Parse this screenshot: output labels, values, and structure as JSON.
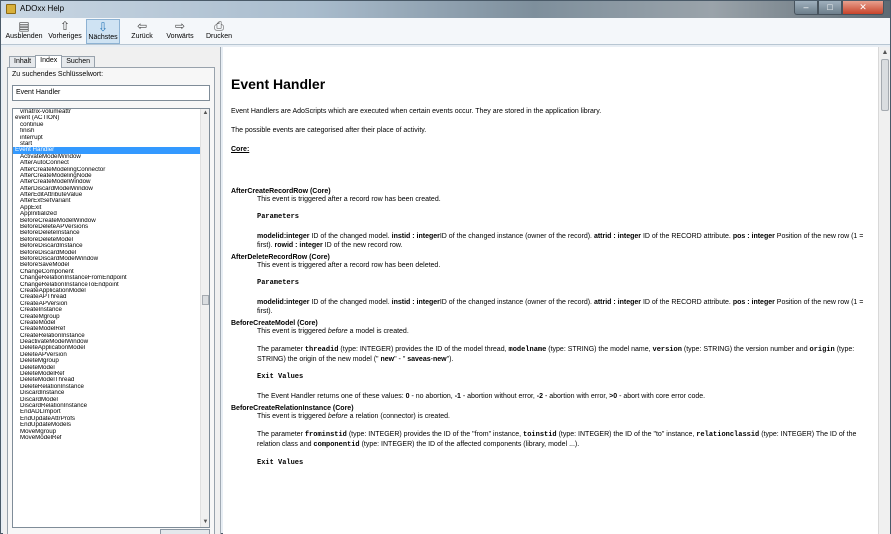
{
  "window": {
    "title": "ADOxx Help",
    "app_icon": "help-book-icon",
    "controls": {
      "minimize": "–",
      "maximize": "□",
      "close": "✕"
    }
  },
  "toolbar": {
    "items": [
      {
        "label": "Ausblenden",
        "icon": "hide-pane-icon",
        "glyph": "▤"
      },
      {
        "label": "Vorheriges",
        "icon": "arrow-up-icon",
        "glyph": "⇧"
      },
      {
        "label": "Nächstes",
        "icon": "arrow-down-icon",
        "glyph": "⇩"
      },
      {
        "label": "Zurück",
        "icon": "arrow-left-icon",
        "glyph": "⇦"
      },
      {
        "label": "Vorwärts",
        "icon": "arrow-right-icon",
        "glyph": "⇨"
      },
      {
        "label": "Drucken",
        "icon": "printer-icon",
        "glyph": "⎙"
      }
    ]
  },
  "nav": {
    "tabs": [
      "Inhalt",
      "Index",
      "Suchen"
    ],
    "active_tab": "Index",
    "keyword_label": "Zu suchendes Schlüsselwort:",
    "keyword_value": "Event Handler",
    "index_items": [
      {
        "t": "vmatrix-volumeattr",
        "sub": true
      },
      {
        "t": "event (ACTION)",
        "sub": false
      },
      {
        "t": "continue",
        "sub": true
      },
      {
        "t": "finish",
        "sub": true
      },
      {
        "t": "interrupt",
        "sub": true
      },
      {
        "t": "start",
        "sub": true
      },
      {
        "t": "Event Handler",
        "sub": false,
        "selected": true
      },
      {
        "t": "ActivateModelWindow",
        "sub": true
      },
      {
        "t": "AfterAutoConnect",
        "sub": true
      },
      {
        "t": "AfterCreateModelingConnector",
        "sub": true
      },
      {
        "t": "AfterCreateModelingNode",
        "sub": true
      },
      {
        "t": "AfterCreateModelWindow",
        "sub": true
      },
      {
        "t": "AfterDiscardModelWindow",
        "sub": true
      },
      {
        "t": "AfterEditAttributeValue",
        "sub": true
      },
      {
        "t": "AfterExtSetVariant",
        "sub": true
      },
      {
        "t": "AppExit",
        "sub": true
      },
      {
        "t": "AppInitialized",
        "sub": true
      },
      {
        "t": "BeforeCreateModelWindow",
        "sub": true
      },
      {
        "t": "BeforeDeleteAPVersions",
        "sub": true
      },
      {
        "t": "BeforeDeleteInstance",
        "sub": true
      },
      {
        "t": "BeforeDeleteModel",
        "sub": true
      },
      {
        "t": "BeforeDiscardInstance",
        "sub": true
      },
      {
        "t": "BeforeDiscardModel",
        "sub": true
      },
      {
        "t": "BeforeDiscardModelWindow",
        "sub": true
      },
      {
        "t": "BeforeSaveModel",
        "sub": true
      },
      {
        "t": "ChangeComponent",
        "sub": true
      },
      {
        "t": "ChangeRelationInstanceFromEndpoint",
        "sub": true
      },
      {
        "t": "ChangeRelationInstanceToEndpoint",
        "sub": true
      },
      {
        "t": "CreateApplicationModel",
        "sub": true
      },
      {
        "t": "CreateAPThread",
        "sub": true
      },
      {
        "t": "CreateAPVersion",
        "sub": true
      },
      {
        "t": "CreateInstance",
        "sub": true
      },
      {
        "t": "CreateMgroup",
        "sub": true
      },
      {
        "t": "CreateModel",
        "sub": true
      },
      {
        "t": "CreateModelRef",
        "sub": true
      },
      {
        "t": "CreateRelationInstance",
        "sub": true
      },
      {
        "t": "DeactivateModelWindow",
        "sub": true
      },
      {
        "t": "DeleteApplicationModel",
        "sub": true
      },
      {
        "t": "DeleteAPVersion",
        "sub": true
      },
      {
        "t": "DeleteMgroup",
        "sub": true
      },
      {
        "t": "DeleteModel",
        "sub": true
      },
      {
        "t": "DeleteModelRef",
        "sub": true
      },
      {
        "t": "DeleteModelThread",
        "sub": true
      },
      {
        "t": "DeleteRelationInstance",
        "sub": true
      },
      {
        "t": "DiscardInstance",
        "sub": true
      },
      {
        "t": "DiscardModel",
        "sub": true
      },
      {
        "t": "DiscardRelationInstance",
        "sub": true
      },
      {
        "t": "EndADLImport",
        "sub": true
      },
      {
        "t": "EndUpdateAttrProfs",
        "sub": true
      },
      {
        "t": "EndUpdateModels",
        "sub": true
      },
      {
        "t": "MoveMgroup",
        "sub": true
      },
      {
        "t": "MoveModelRef",
        "sub": true
      }
    ]
  },
  "doc": {
    "title": "Event Handler",
    "intro1": "Event Handlers are AdoScripts which are executed when certain events occur. They are stored in the application library.",
    "intro2": "The possible events are categorised after their place of activity.",
    "core_heading": "Core:",
    "e1_title": "AfterCreateRecordRow (Core)",
    "e1_desc": "This event is triggered after a record row has been created.",
    "params_label": "Parameters",
    "e1_p": [
      {
        "b": "modelid:integer"
      },
      {
        "t": " ID of the changed model. "
      },
      {
        "b": "instid : integer"
      },
      {
        "t": "ID of the changed instance (owner of the record). "
      },
      {
        "b": "attrid : integer"
      },
      {
        "t": " ID of the RECORD attribute. "
      },
      {
        "b": "pos : integer"
      },
      {
        "t": " Position of the new row (1 = first). "
      },
      {
        "b": "rowid : integer"
      },
      {
        "t": " ID of the new record row."
      }
    ],
    "e2_title": "AfterDeleteRecordRow (Core)",
    "e2_desc": "This event is triggered after a record row has been deleted.",
    "e2_p": [
      {
        "b": "modelid:integer"
      },
      {
        "t": " ID of the changed model. "
      },
      {
        "b": "instid : integer"
      },
      {
        "t": "ID of the changed instance (owner of the record). "
      },
      {
        "b": "attrid : integer"
      },
      {
        "t": " ID of the RECORD attribute. "
      },
      {
        "b": "pos : integer"
      },
      {
        "t": " Position of the new row (1 = first)."
      }
    ],
    "e3_title": "BeforeCreateModel (Core)",
    "e3_desc_pre": "This event is triggered ",
    "e3_desc_em": "before",
    "e3_desc_post": " a model is created.",
    "e3_p": [
      {
        "t": "The parameter "
      },
      {
        "c": "threadid"
      },
      {
        "t": " (type: INTEGER) provides the ID of the model thread, "
      },
      {
        "c": "modelname"
      },
      {
        "t": " (type: STRING) the model name, "
      },
      {
        "c": "version"
      },
      {
        "t": " (type: STRING) the version number and "
      },
      {
        "c": "origin"
      },
      {
        "t": " (type: STRING) the origin of the new model (\""
      },
      {
        "b": " new"
      },
      {
        "t": "\" - \""
      },
      {
        "b": " saveas"
      },
      {
        "t": "-"
      },
      {
        "b": "new"
      },
      {
        "t": "\")."
      }
    ],
    "exit_label": "Exit Values",
    "e3_exit": [
      {
        "t": "The Event Handler returns one of these values: "
      },
      {
        "b": "0"
      },
      {
        "t": " - no abortion, "
      },
      {
        "b": "-1"
      },
      {
        "t": " - abortion without error, "
      },
      {
        "b": "-2"
      },
      {
        "t": " - abortion with error, "
      },
      {
        "b": ">0"
      },
      {
        "t": " - abort with core error code."
      }
    ],
    "e4_title": "BeforeCreateRelationInstance (Core)",
    "e4_desc_pre": "This event is triggered ",
    "e4_desc_em": "before",
    "e4_desc_post": " a relation (connector) is created.",
    "e4_p": [
      {
        "t": "The parameter "
      },
      {
        "c": "frominstid"
      },
      {
        "t": " (type: INTEGER) provides the ID of the \"from\" instance, "
      },
      {
        "c": "toinstid"
      },
      {
        "t": " (type: INTEGER) the ID of the \"to\" instance, "
      },
      {
        "c": "relationclassid"
      },
      {
        "t": " (type: INTEGER) The ID of the relation class and "
      },
      {
        "c": "componentid"
      },
      {
        "t": " (type: INTEGER) the ID of the affected components (library, model ...)."
      }
    ]
  },
  "colors": {
    "selection": "#3399ff",
    "toolbar_active": "#cfe3f3",
    "titlebar": "#a9bccd"
  }
}
